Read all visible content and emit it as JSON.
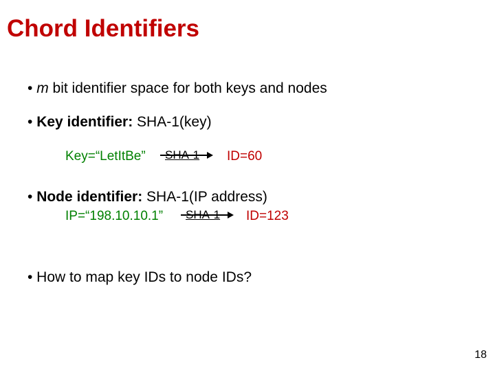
{
  "title": "Chord Identifiers",
  "bullet1_prefix": "• ",
  "bullet1_m": "m",
  "bullet1_rest": "  bit identifier space for both keys and nodes",
  "bullet2_prefix": "• ",
  "bullet2_bold": "Key identifier:",
  "bullet2_rest": " SHA-1(key)",
  "ex1_key": "Key=“LetItBe”",
  "ex1_sha": "SHA-1",
  "ex1_id": "ID=60",
  "bullet3_prefix": "• ",
  "bullet3_bold": "Node identifier:",
  "bullet3_rest": " SHA-1(IP address)",
  "ex2_ip": "IP=“198.10.10.1”",
  "ex2_sha": "SHA-1",
  "ex2_id": "ID=123",
  "bullet4": "• How to map key IDs to node IDs?",
  "page_number": "18"
}
